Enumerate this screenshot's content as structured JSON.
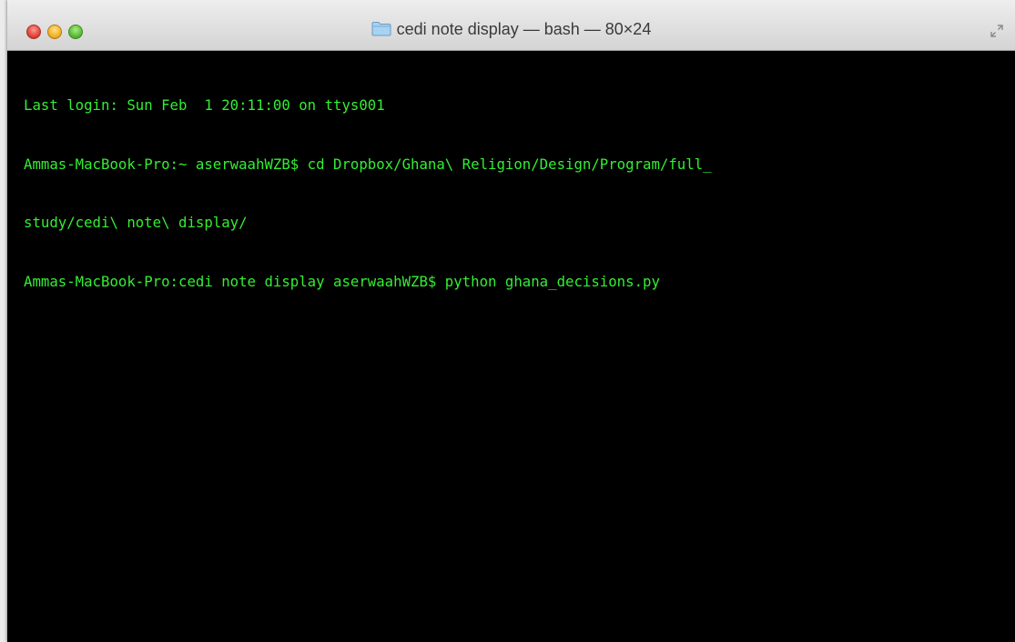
{
  "window": {
    "title": "cedi note display — bash — 80×24",
    "icons": {
      "title": "folder-icon",
      "resize": "fullscreen-icon"
    }
  },
  "terminal": {
    "text_color": "#33ee33",
    "background": "#000000",
    "lines": [
      "Last login: Sun Feb  1 20:11:00 on ttys001",
      "Ammas-MacBook-Pro:~ aserwaahWZB$ cd Dropbox/Ghana\\ Religion/Design/Program/full_",
      "study/cedi\\ note\\ display/",
      "Ammas-MacBook-Pro:cedi note display aserwaahWZB$ python ghana_decisions.py"
    ]
  }
}
